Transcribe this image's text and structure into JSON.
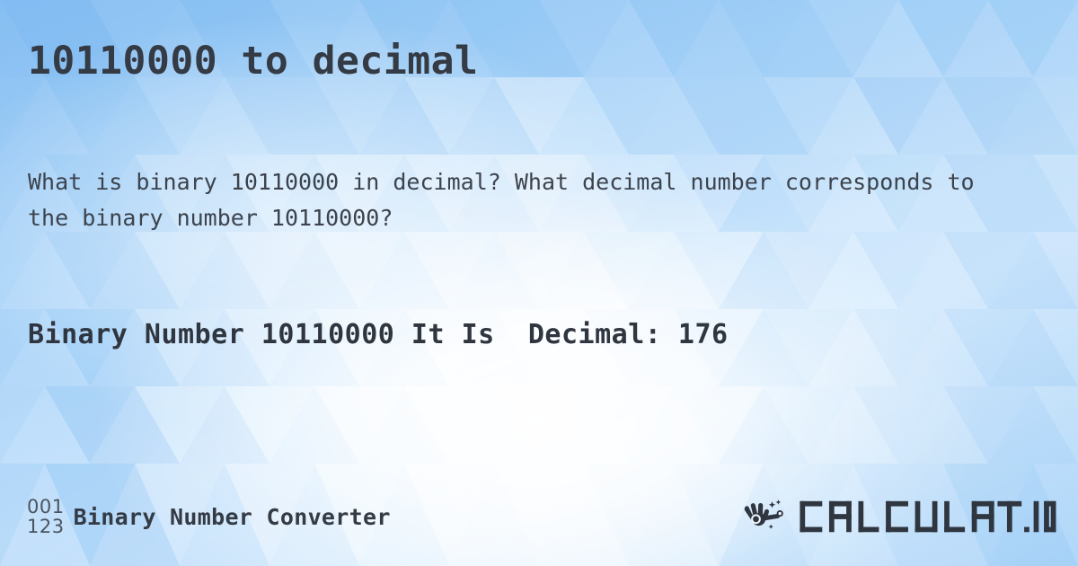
{
  "page": {
    "title": "10110000 to decimal",
    "question": "What is binary 10110000 in decimal? What decimal number corresponds to the binary number 10110000?",
    "result": "Binary Number 10110000 It Is  Decimal: 176"
  },
  "values": {
    "binary_number": "10110000",
    "decimal_number": "176",
    "binary_label": "Binary Number",
    "it_is_label": "It Is",
    "decimal_label": "Decimal:"
  },
  "footer": {
    "logo_top": "001",
    "logo_bottom": "123",
    "site_name": "Binary Number Converter",
    "brand": "CALCULAT.IO",
    "brand_icon": "hand-wand-icon"
  },
  "colors": {
    "heading": "#343b45",
    "body_text": "#3c434d",
    "result_text": "#2f3640",
    "logo_digits": "#4a5560",
    "brand_mark": "#2f3640",
    "background_blue": "#8ec5f5",
    "background_light": "#f4f9fe"
  }
}
